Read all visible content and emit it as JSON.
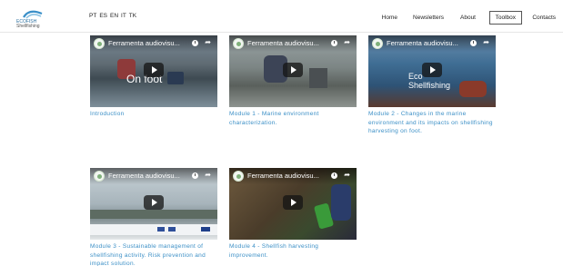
{
  "header": {
    "logo_line1": "ECOFISH",
    "logo_line2": "Shellfishing",
    "languages": [
      "PT",
      "ES",
      "EN",
      "IT",
      "TK"
    ],
    "nav": [
      {
        "label": "Home"
      },
      {
        "label": "Newsletters"
      },
      {
        "label": "About"
      },
      {
        "label": "Toolbox",
        "active": true
      },
      {
        "label": "Contacts"
      }
    ]
  },
  "videos": [
    {
      "title": "Ferramenta audiovisu...",
      "caption": "Introduction",
      "overlay": "On foot"
    },
    {
      "title": "Ferramenta audiovisu...",
      "caption": "Module 1 - Marine environment characterization.",
      "overlay": ""
    },
    {
      "title": "Ferramenta audiovisu...",
      "caption": "Module 2 - Changes in the marine environment and its impacts on shellfishing harvesting on foot.",
      "overlay": "Eco Shellfishing"
    },
    {
      "title": "Ferramenta audiovisu...",
      "caption": "Module 3 - Sustainable management of shellfishing activity. Risk prevention and impact solution.",
      "overlay": ""
    },
    {
      "title": "Ferramenta audiovisu...",
      "caption": "Module 4 - Shellfish harvesting improvement.",
      "overlay": ""
    }
  ]
}
